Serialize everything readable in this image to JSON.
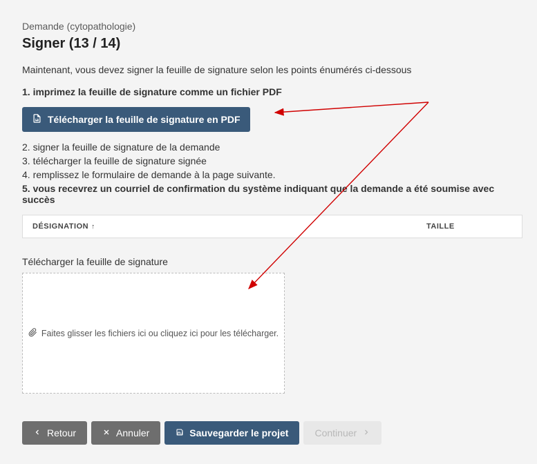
{
  "breadcrumb": "Demande (cytopathologie)",
  "title": "Signer (13 / 14)",
  "intro": "Maintenant, vous devez signer la feuille de signature selon les points énumérés ci-dessous",
  "steps": {
    "s1": "1. imprimez la feuille de signature comme un fichier PDF",
    "s2": "2. signer la feuille de signature de la demande",
    "s3": "3. télécharger la feuille de signature signée",
    "s4": "4. remplissez le formulaire de demande à la page suivante.",
    "s5": "5. vous recevrez un courriel de confirmation du système indiquant que la demande a été soumise avec succès"
  },
  "download_button": "Télécharger la feuille de signature en PDF",
  "table": {
    "col_designation": "DÉSIGNATION",
    "col_taille": "TAILLE"
  },
  "upload": {
    "label": "Télécharger la feuille de signature",
    "dropzone_text": "Faites glisser les fichiers ici ou cliquez ici pour les télécharger."
  },
  "buttons": {
    "back": "Retour",
    "cancel": "Annuler",
    "save": "Sauvegarder le projet",
    "continue": "Continuer"
  }
}
